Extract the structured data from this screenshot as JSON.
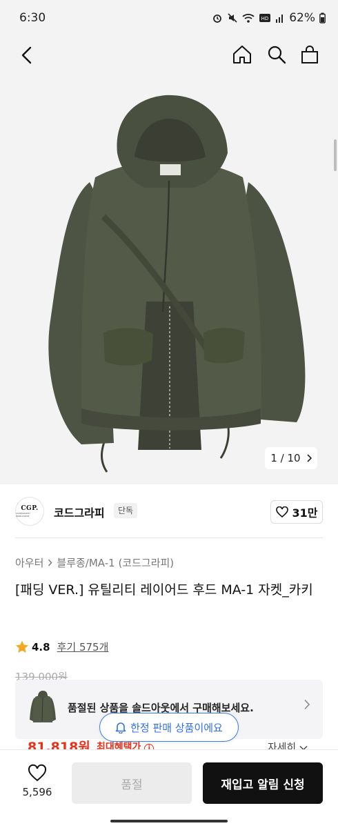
{
  "status": {
    "time": "6:30",
    "battery": "62%",
    "icons": [
      "alarm-icon",
      "mute-icon",
      "wifi-icon",
      "hd-voice-icon",
      "signal-icon",
      "battery-icon"
    ]
  },
  "header": {
    "icons": [
      "back-icon",
      "home-icon",
      "search-icon",
      "cart-icon"
    ]
  },
  "gallery": {
    "counter": "1 / 10"
  },
  "brand": {
    "logo_text": "CGP.",
    "logo_subtext": "CODEGRAPHY WORLDWIDE",
    "name": "코드그라피",
    "badge": "단독",
    "likes": "31만"
  },
  "product": {
    "breadcrumb_1": "아우터",
    "breadcrumb_2": "블루종/MA-1 (코드그라피)",
    "title": "[패딩 VER.] 유틸리티 레이어드 후드 MA-1 자켓_카키",
    "rating": "4.8",
    "reviews": "후기 575개"
  },
  "price": {
    "original": "139,000원",
    "sale": "81,818원",
    "benefit_label": "최대혜택가",
    "detail": "자세히"
  },
  "soldout_banner": {
    "text": "품절된 상품을 솔드아웃에서 구매해보세요."
  },
  "limited_pill": {
    "text": "한정 판매 상품이에요"
  },
  "bottom_bar": {
    "wish_count": "5,596",
    "soldout_label": "품절",
    "restock_label": "재입고 알림 신청"
  },
  "colors": {
    "accent_blue": "#2f6fe8",
    "sale_red": "#e8311a",
    "jacket_khaki": "#4e5443"
  }
}
